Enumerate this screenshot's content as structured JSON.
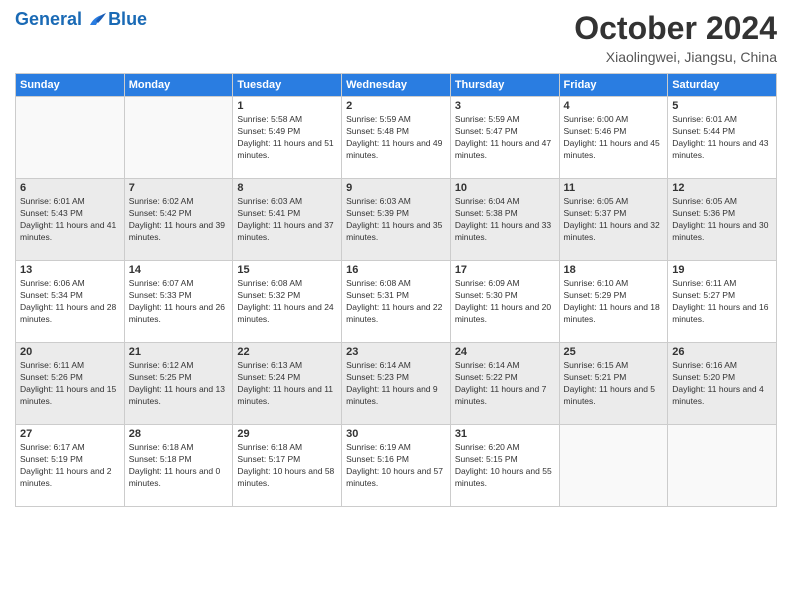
{
  "logo": {
    "line1": "General",
    "line2": "Blue"
  },
  "title": "October 2024",
  "subtitle": "Xiaolingwei, Jiangsu, China",
  "days_of_week": [
    "Sunday",
    "Monday",
    "Tuesday",
    "Wednesday",
    "Thursday",
    "Friday",
    "Saturday"
  ],
  "weeks": [
    {
      "shaded": false,
      "days": [
        {
          "number": "",
          "sunrise": "",
          "sunset": "",
          "daylight": "",
          "empty": true
        },
        {
          "number": "",
          "sunrise": "",
          "sunset": "",
          "daylight": "",
          "empty": true
        },
        {
          "number": "1",
          "sunrise": "Sunrise: 5:58 AM",
          "sunset": "Sunset: 5:49 PM",
          "daylight": "Daylight: 11 hours and 51 minutes.",
          "empty": false
        },
        {
          "number": "2",
          "sunrise": "Sunrise: 5:59 AM",
          "sunset": "Sunset: 5:48 PM",
          "daylight": "Daylight: 11 hours and 49 minutes.",
          "empty": false
        },
        {
          "number": "3",
          "sunrise": "Sunrise: 5:59 AM",
          "sunset": "Sunset: 5:47 PM",
          "daylight": "Daylight: 11 hours and 47 minutes.",
          "empty": false
        },
        {
          "number": "4",
          "sunrise": "Sunrise: 6:00 AM",
          "sunset": "Sunset: 5:46 PM",
          "daylight": "Daylight: 11 hours and 45 minutes.",
          "empty": false
        },
        {
          "number": "5",
          "sunrise": "Sunrise: 6:01 AM",
          "sunset": "Sunset: 5:44 PM",
          "daylight": "Daylight: 11 hours and 43 minutes.",
          "empty": false
        }
      ]
    },
    {
      "shaded": true,
      "days": [
        {
          "number": "6",
          "sunrise": "Sunrise: 6:01 AM",
          "sunset": "Sunset: 5:43 PM",
          "daylight": "Daylight: 11 hours and 41 minutes.",
          "empty": false
        },
        {
          "number": "7",
          "sunrise": "Sunrise: 6:02 AM",
          "sunset": "Sunset: 5:42 PM",
          "daylight": "Daylight: 11 hours and 39 minutes.",
          "empty": false
        },
        {
          "number": "8",
          "sunrise": "Sunrise: 6:03 AM",
          "sunset": "Sunset: 5:41 PM",
          "daylight": "Daylight: 11 hours and 37 minutes.",
          "empty": false
        },
        {
          "number": "9",
          "sunrise": "Sunrise: 6:03 AM",
          "sunset": "Sunset: 5:39 PM",
          "daylight": "Daylight: 11 hours and 35 minutes.",
          "empty": false
        },
        {
          "number": "10",
          "sunrise": "Sunrise: 6:04 AM",
          "sunset": "Sunset: 5:38 PM",
          "daylight": "Daylight: 11 hours and 33 minutes.",
          "empty": false
        },
        {
          "number": "11",
          "sunrise": "Sunrise: 6:05 AM",
          "sunset": "Sunset: 5:37 PM",
          "daylight": "Daylight: 11 hours and 32 minutes.",
          "empty": false
        },
        {
          "number": "12",
          "sunrise": "Sunrise: 6:05 AM",
          "sunset": "Sunset: 5:36 PM",
          "daylight": "Daylight: 11 hours and 30 minutes.",
          "empty": false
        }
      ]
    },
    {
      "shaded": false,
      "days": [
        {
          "number": "13",
          "sunrise": "Sunrise: 6:06 AM",
          "sunset": "Sunset: 5:34 PM",
          "daylight": "Daylight: 11 hours and 28 minutes.",
          "empty": false
        },
        {
          "number": "14",
          "sunrise": "Sunrise: 6:07 AM",
          "sunset": "Sunset: 5:33 PM",
          "daylight": "Daylight: 11 hours and 26 minutes.",
          "empty": false
        },
        {
          "number": "15",
          "sunrise": "Sunrise: 6:08 AM",
          "sunset": "Sunset: 5:32 PM",
          "daylight": "Daylight: 11 hours and 24 minutes.",
          "empty": false
        },
        {
          "number": "16",
          "sunrise": "Sunrise: 6:08 AM",
          "sunset": "Sunset: 5:31 PM",
          "daylight": "Daylight: 11 hours and 22 minutes.",
          "empty": false
        },
        {
          "number": "17",
          "sunrise": "Sunrise: 6:09 AM",
          "sunset": "Sunset: 5:30 PM",
          "daylight": "Daylight: 11 hours and 20 minutes.",
          "empty": false
        },
        {
          "number": "18",
          "sunrise": "Sunrise: 6:10 AM",
          "sunset": "Sunset: 5:29 PM",
          "daylight": "Daylight: 11 hours and 18 minutes.",
          "empty": false
        },
        {
          "number": "19",
          "sunrise": "Sunrise: 6:11 AM",
          "sunset": "Sunset: 5:27 PM",
          "daylight": "Daylight: 11 hours and 16 minutes.",
          "empty": false
        }
      ]
    },
    {
      "shaded": true,
      "days": [
        {
          "number": "20",
          "sunrise": "Sunrise: 6:11 AM",
          "sunset": "Sunset: 5:26 PM",
          "daylight": "Daylight: 11 hours and 15 minutes.",
          "empty": false
        },
        {
          "number": "21",
          "sunrise": "Sunrise: 6:12 AM",
          "sunset": "Sunset: 5:25 PM",
          "daylight": "Daylight: 11 hours and 13 minutes.",
          "empty": false
        },
        {
          "number": "22",
          "sunrise": "Sunrise: 6:13 AM",
          "sunset": "Sunset: 5:24 PM",
          "daylight": "Daylight: 11 hours and 11 minutes.",
          "empty": false
        },
        {
          "number": "23",
          "sunrise": "Sunrise: 6:14 AM",
          "sunset": "Sunset: 5:23 PM",
          "daylight": "Daylight: 11 hours and 9 minutes.",
          "empty": false
        },
        {
          "number": "24",
          "sunrise": "Sunrise: 6:14 AM",
          "sunset": "Sunset: 5:22 PM",
          "daylight": "Daylight: 11 hours and 7 minutes.",
          "empty": false
        },
        {
          "number": "25",
          "sunrise": "Sunrise: 6:15 AM",
          "sunset": "Sunset: 5:21 PM",
          "daylight": "Daylight: 11 hours and 5 minutes.",
          "empty": false
        },
        {
          "number": "26",
          "sunrise": "Sunrise: 6:16 AM",
          "sunset": "Sunset: 5:20 PM",
          "daylight": "Daylight: 11 hours and 4 minutes.",
          "empty": false
        }
      ]
    },
    {
      "shaded": false,
      "days": [
        {
          "number": "27",
          "sunrise": "Sunrise: 6:17 AM",
          "sunset": "Sunset: 5:19 PM",
          "daylight": "Daylight: 11 hours and 2 minutes.",
          "empty": false
        },
        {
          "number": "28",
          "sunrise": "Sunrise: 6:18 AM",
          "sunset": "Sunset: 5:18 PM",
          "daylight": "Daylight: 11 hours and 0 minutes.",
          "empty": false
        },
        {
          "number": "29",
          "sunrise": "Sunrise: 6:18 AM",
          "sunset": "Sunset: 5:17 PM",
          "daylight": "Daylight: 10 hours and 58 minutes.",
          "empty": false
        },
        {
          "number": "30",
          "sunrise": "Sunrise: 6:19 AM",
          "sunset": "Sunset: 5:16 PM",
          "daylight": "Daylight: 10 hours and 57 minutes.",
          "empty": false
        },
        {
          "number": "31",
          "sunrise": "Sunrise: 6:20 AM",
          "sunset": "Sunset: 5:15 PM",
          "daylight": "Daylight: 10 hours and 55 minutes.",
          "empty": false
        },
        {
          "number": "",
          "sunrise": "",
          "sunset": "",
          "daylight": "",
          "empty": true
        },
        {
          "number": "",
          "sunrise": "",
          "sunset": "",
          "daylight": "",
          "empty": true
        }
      ]
    }
  ]
}
